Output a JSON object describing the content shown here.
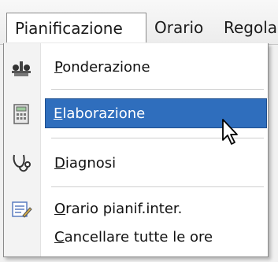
{
  "menubar": {
    "items": [
      {
        "label": "Pianificazione"
      },
      {
        "label": "Orario"
      },
      {
        "label": "Regola"
      }
    ]
  },
  "menu": {
    "items": [
      {
        "label": "Ponderazione",
        "mnemonic": "P",
        "rest": "onderazione",
        "icon": "weights-icon"
      },
      {
        "label": "Elaborazione",
        "mnemonic": "E",
        "rest": "laborazione",
        "icon": "calculator-icon",
        "highlighted": true
      },
      {
        "label": "Diagnosi",
        "mnemonic": "D",
        "rest": "iagnosi",
        "icon": "stethoscope-icon"
      },
      {
        "label": "Orario pianif.inter.",
        "mnemonic": "O",
        "rest": "rario pianif.inter.",
        "icon": "edit-schedule-icon"
      },
      {
        "label": "Cancellare tutte le ore",
        "mnemonic": "C",
        "rest": "ancellare tutte le ore",
        "icon": ""
      }
    ]
  },
  "colors": {
    "highlight": "#2f6ebd",
    "menu_bg": "#ffffff",
    "gutter": "#f3f3f3"
  }
}
